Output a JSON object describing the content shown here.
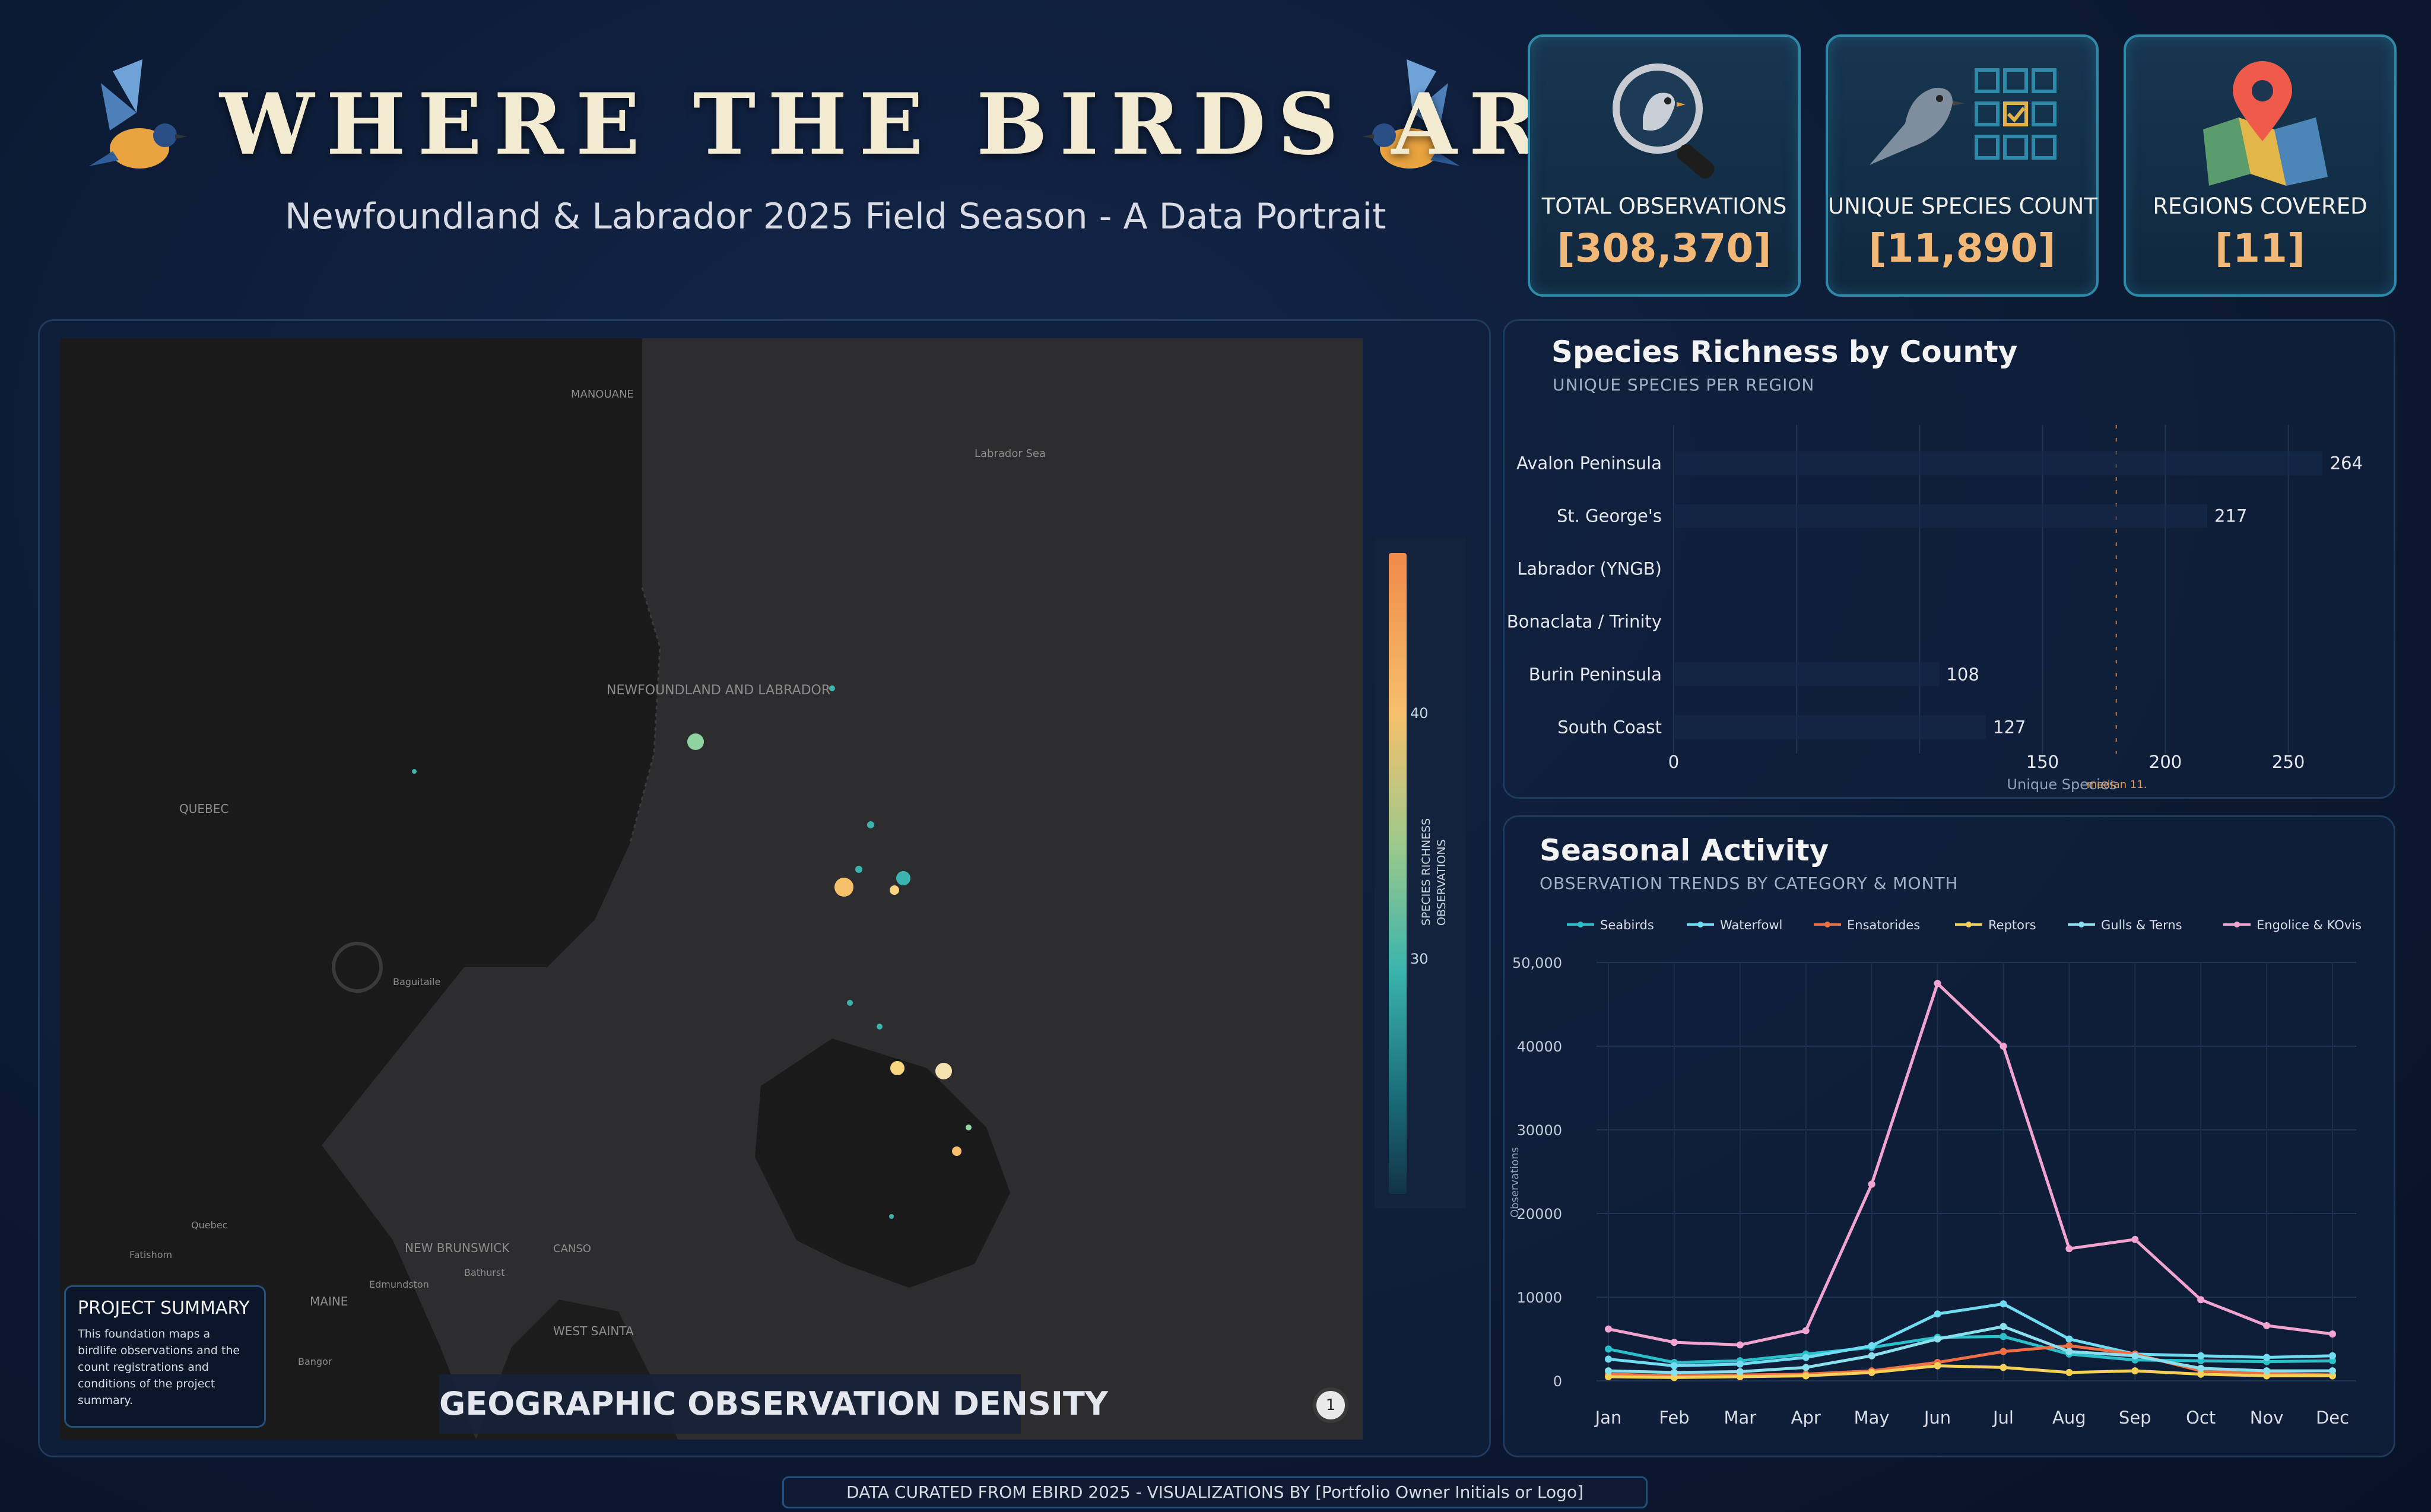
{
  "header": {
    "title": "WHERE THE BIRDS ARE",
    "subtitle": "Newfoundland & Labrador 2025 Field Season - A Data Portrait"
  },
  "kpis": [
    {
      "label": "TOTAL OBSERVATIONS",
      "value": "[308,370]",
      "icon": "magnifier-bird-icon"
    },
    {
      "label": "UNIQUE SPECIES COUNT",
      "value": "[11,890]",
      "icon": "bird-checklist-icon"
    },
    {
      "label": "REGIONS COVERED",
      "value": "[11]",
      "icon": "map-pin-icon"
    }
  ],
  "map": {
    "caption": "GEOGRAPHIC OBSERVATION DENSITY",
    "places": [
      "MANOUANE",
      "Labrador Sea",
      "NEWFOUNDLAND AND LABRADOR",
      "QUEBEC",
      "Baguitaile",
      "NEW BRUNSWICK",
      "MAINE",
      "WEST SAINTA",
      "Quebec",
      "Bangor",
      "Fatishom",
      "Edmundston",
      "Bathurst",
      "CANSO"
    ],
    "colorbar": {
      "ticks": [
        "40",
        "30"
      ],
      "title_line1": "SPECIES RICHNESS",
      "title_line2": "OBSERVATIONS"
    },
    "compass_label": "1",
    "summary": {
      "title": "PROJECT SUMMARY",
      "body": "This foundation maps a birdlife observations and the count registrations and conditions of the project summary."
    }
  },
  "colors": {
    "accent": "#2e8aa8",
    "kpi_value": "#f2b877",
    "panel_bg": "#10203c"
  },
  "richness": {
    "title": "Species Richness by County",
    "subtitle": "UNIQUE SPECIES PER REGION",
    "xlabel": "Unique Species",
    "median_label": "median 11.",
    "x_ticks": [
      "0",
      "150",
      "200",
      "250"
    ]
  },
  "seasonal": {
    "title": "Seasonal Activity",
    "subtitle": "OBSERVATION TRENDS BY CATEGORY & MONTH",
    "ylabel": "Observations"
  },
  "chart_data": [
    {
      "type": "bar",
      "title": "Species Richness by County",
      "subtitle": "UNIQUE SPECIES PER REGION",
      "xlabel": "Unique Species",
      "orientation": "horizontal",
      "categories": [
        "Avalon Peninsula",
        "St. George's",
        "Labrador (YNGB)",
        "Bonaclata / Trinity",
        "Burin Peninsula",
        "South Coast"
      ],
      "values": [
        264,
        217,
        null,
        null,
        108,
        127
      ],
      "labels": [
        "264",
        "217",
        "",
        "",
        "108",
        "127"
      ],
      "xlim": [
        0,
        280
      ],
      "median": 180
    },
    {
      "type": "line",
      "title": "Seasonal Activity",
      "subtitle": "OBSERVATION TRENDS BY CATEGORY & MONTH",
      "ylabel": "Observations",
      "categories": [
        "Jan",
        "Feb",
        "Mar",
        "Apr",
        "May",
        "Jun",
        "Jul",
        "Aug",
        "Sep",
        "Oct",
        "Nov",
        "Dec"
      ],
      "y_ticks": [
        "50,000",
        "40000",
        "30000",
        "20000",
        "10000",
        "0"
      ],
      "ylim": [
        0,
        50000
      ],
      "legend": "top",
      "series": [
        {
          "name": "Seabirds",
          "color": "#2bc0c9",
          "values": [
            3800,
            2200,
            2400,
            3200,
            4000,
            5200,
            5300,
            3200,
            2500,
            2400,
            2300,
            2400
          ]
        },
        {
          "name": "Waterfowl",
          "color": "#6fdcf2",
          "values": [
            2600,
            1800,
            2000,
            2800,
            4200,
            8000,
            9200,
            5000,
            3200,
            3000,
            2800,
            3000
          ]
        },
        {
          "name": "Ensatorides",
          "color": "#ef6f45",
          "values": [
            800,
            600,
            700,
            800,
            1200,
            2200,
            3500,
            4200,
            3200,
            1200,
            900,
            700
          ]
        },
        {
          "name": "Reptors",
          "color": "#f6d057",
          "values": [
            500,
            400,
            500,
            600,
            1000,
            1800,
            1600,
            1000,
            1200,
            800,
            600,
            600
          ]
        },
        {
          "name": "Gulls & Terns",
          "color": "#8be0ee",
          "values": [
            1200,
            1000,
            1100,
            1600,
            3000,
            5000,
            6500,
            3500,
            3000,
            1500,
            1200,
            1200
          ]
        },
        {
          "name": "Engolice & KOvis",
          "color": "#f2a4d0",
          "values": [
            6200,
            4600,
            4300,
            6000,
            23500,
            47500,
            40000,
            15800,
            16900,
            9700,
            6600,
            5600
          ]
        }
      ]
    }
  ],
  "footer": {
    "text": "DATA CURATED FROM EBIRD 2025  -  VISUALIZATIONS BY [Portfolio Owner Initials or Logo]"
  }
}
